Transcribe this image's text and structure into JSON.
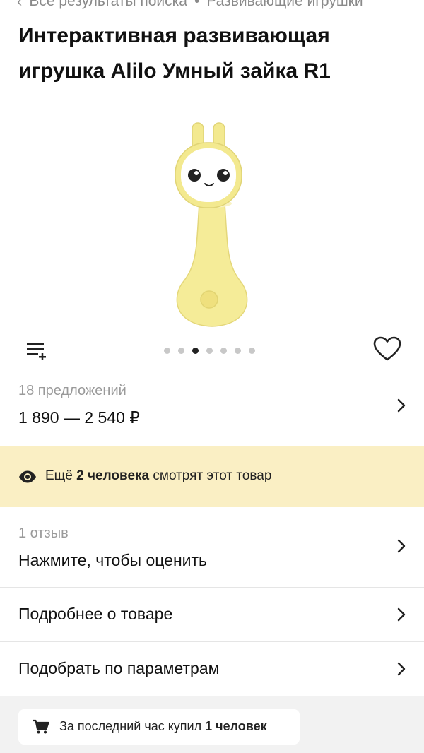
{
  "breadcrumb": {
    "back_label": "Все результаты поиска",
    "separator": "•",
    "category": "Развивающие игрушки"
  },
  "product": {
    "title": "Интерактивная развивающая игрушка Alilo Умный зайка R1",
    "image_icon": "yellow-bunny-rattle-toy",
    "gallery_dots_total": 7,
    "gallery_dots_active": 3
  },
  "offers": {
    "count_label": "18 предложений",
    "price_range": "1 890 — 2 540 ₽"
  },
  "watching": {
    "prefix": "Ещё",
    "count": "2 человека",
    "suffix": "смотрят этот товар"
  },
  "reviews": {
    "count_label": "1 отзыв",
    "action_label": "Нажмите, чтобы оценить"
  },
  "menu": {
    "details_label": "Подробнее о товаре",
    "params_label": "Подобрать по параметрам"
  },
  "purchases": {
    "prefix": "За последний час купил",
    "count": "1 человек"
  },
  "colors": {
    "banner_bg": "#faefc4",
    "toy_yellow": "#f3e98f",
    "footer_bg": "#f2f2f2"
  }
}
